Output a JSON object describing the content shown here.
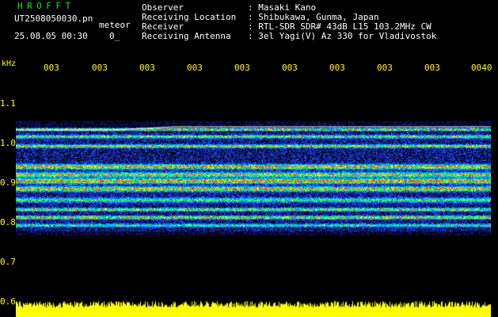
{
  "header": {
    "brand": "HROFFT",
    "filename": "UT2508050030.pn",
    "tag": "meteor",
    "timestamp": "25.08.05 00:30",
    "subvalue": "0_"
  },
  "station": {
    "rows": [
      {
        "label": "Observer",
        "value": ": Masaki Kano"
      },
      {
        "label": "Receiving Location",
        "value": ": Shibukawa, Gunma, Japan"
      },
      {
        "label": "Receiver",
        "value": ": RTL-SDR SDR# 43dB L15 103.2MHz CW"
      },
      {
        "label": "Receiving Antenna",
        "value": ": 3el Yagi(V) Az 330 for Vladivostok"
      }
    ]
  },
  "axes": {
    "y_unit": "kHz",
    "x_ticks": [
      "003",
      "003",
      "003",
      "003",
      "003",
      "003",
      "003",
      "003",
      "003",
      "0040"
    ],
    "y_ticks": [
      "1.1",
      "1.0",
      "0.9",
      "0.8",
      "0.7",
      "0.6"
    ]
  },
  "colors": {
    "tick_text": "#ffff00",
    "brand_text": "#20e020",
    "background": "#000000",
    "noise_floor": "#ffff00"
  }
}
